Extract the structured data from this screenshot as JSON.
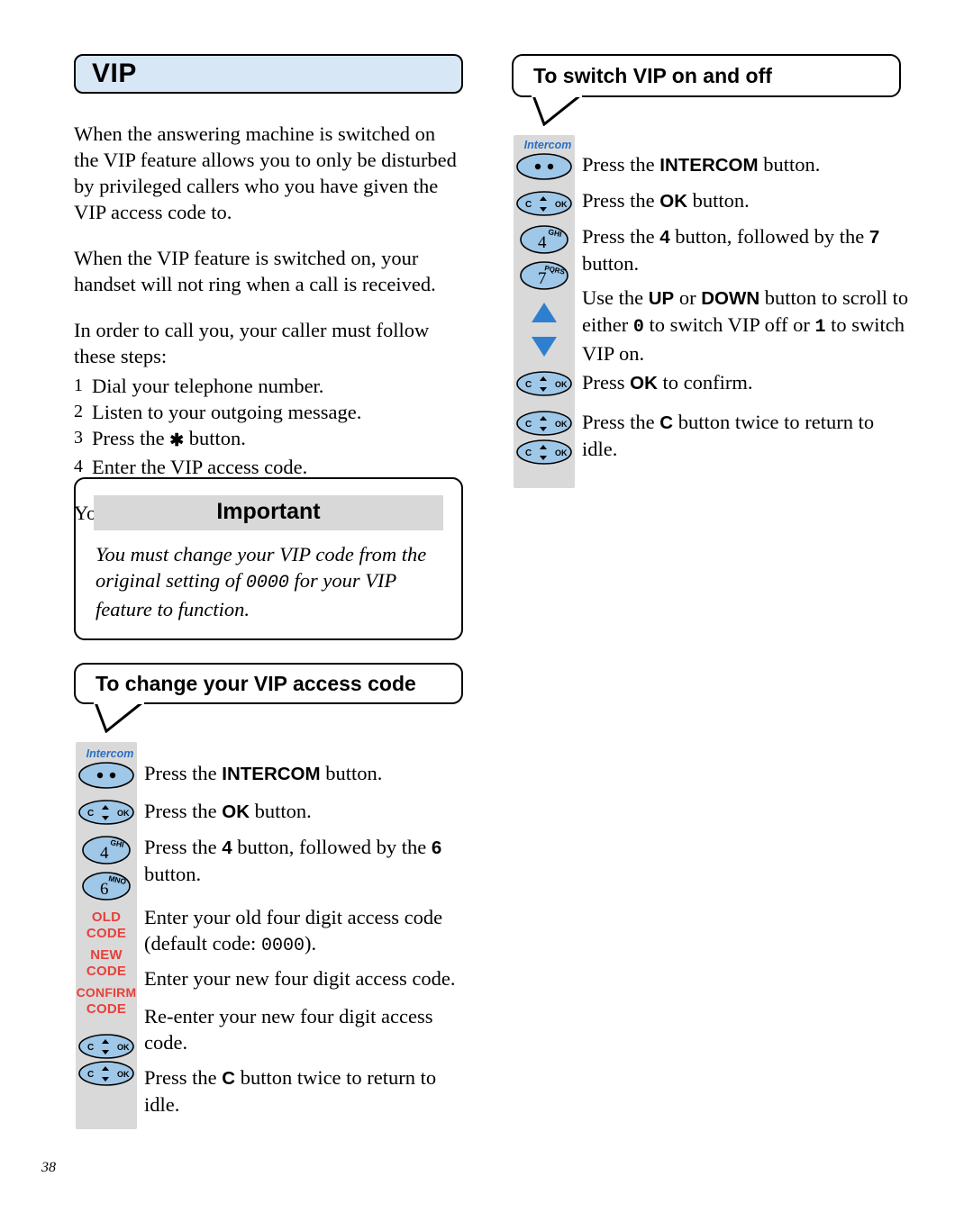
{
  "page": {
    "number": "38"
  },
  "left": {
    "title": "VIP",
    "paragraphs": [
      "When the answering machine is switched on the VIP feature allows you to only be disturbed by privileged callers who you have given the VIP access code to.",
      "When the VIP feature is switched on, your handset will not ring when a call is received.",
      "In order to call you, your caller must follow these steps:"
    ],
    "steps": [
      {
        "n": "1",
        "text": "Dial your telephone number."
      },
      {
        "n": "2",
        "text": "Listen to your outgoing message."
      },
      {
        "n": "3",
        "text_pre": "Press the ",
        "symbol": "✱",
        "text_post": " button."
      },
      {
        "n": "4",
        "text": "Enter the VIP access code."
      }
    ],
    "closing": "Your telephone will now ring.",
    "important": {
      "heading": "Important",
      "text_pre": "You must change your VIP code from the original setting of ",
      "code": "0000",
      "text_post": " for your VIP feature to function."
    },
    "section2": {
      "title": "To change your VIP access code",
      "intercom_label": "Intercom",
      "key_labels": {
        "old": "OLD",
        "old2": "CODE",
        "new": "NEW",
        "new2": "CODE",
        "confirm": "CONFIRM",
        "confirm2": "CODE"
      },
      "keys": {
        "four_digit": "4",
        "four_letters": "GHI",
        "six_digit": "6",
        "six_letters": "MNO",
        "ok": "OK",
        "c": "C"
      },
      "rows": [
        {
          "pre": "Press the ",
          "bold": "INTERCOM",
          "post": " button."
        },
        {
          "pre": "Press the ",
          "bold": "OK",
          "post": " button."
        },
        {
          "pre": "Press the ",
          "bold": "4",
          "post": " button, followed by the ",
          "bold2": "6",
          "post2": " button."
        },
        {
          "pre": "Enter your old four digit access code (default code: ",
          "code": "0000",
          "post": ")."
        },
        {
          "pre": "Enter your new four digit access code."
        },
        {
          "pre": "Re-enter your new four digit access code."
        },
        {
          "pre": "Press the ",
          "bold": "C",
          "post": " button twice to return to idle."
        }
      ]
    }
  },
  "right": {
    "title": "To switch VIP on and off",
    "intercom_label": "Intercom",
    "keys": {
      "four_digit": "4",
      "four_letters": "GHI",
      "seven_digit": "7",
      "seven_letters": "PQRS",
      "ok": "OK",
      "c": "C"
    },
    "rows": [
      {
        "pre": "Press the ",
        "bold": "INTERCOM",
        "post": " button."
      },
      {
        "pre": "Press the ",
        "bold": "OK",
        "post": " button."
      },
      {
        "pre": "Press the ",
        "bold": "4",
        "post": " button, followed by the ",
        "bold2": "7",
        "post2": " button."
      },
      {
        "pre": "Use the ",
        "bold": "UP",
        "mid": " or ",
        "bold2": "DOWN",
        "post": " button to scroll to either ",
        "code1": "0",
        "post2": " to switch VIP off or ",
        "code2": "1",
        "post3": " to switch VIP on."
      },
      {
        "pre": "Press ",
        "bold": "OK",
        "post": " to confirm."
      },
      {
        "pre": "Press the ",
        "bold": "C",
        "post": " button twice to return to idle."
      }
    ]
  },
  "colors": {
    "title_bg": "#d8e7f5",
    "key_blue": "#9ec7e8",
    "key_strip": "#d9d9d9",
    "red_label": "#e8403a",
    "intercom_blue": "#2a6fc4",
    "arrow_blue": "#2f7fd0",
    "important_bg": "#d8d8d8"
  }
}
